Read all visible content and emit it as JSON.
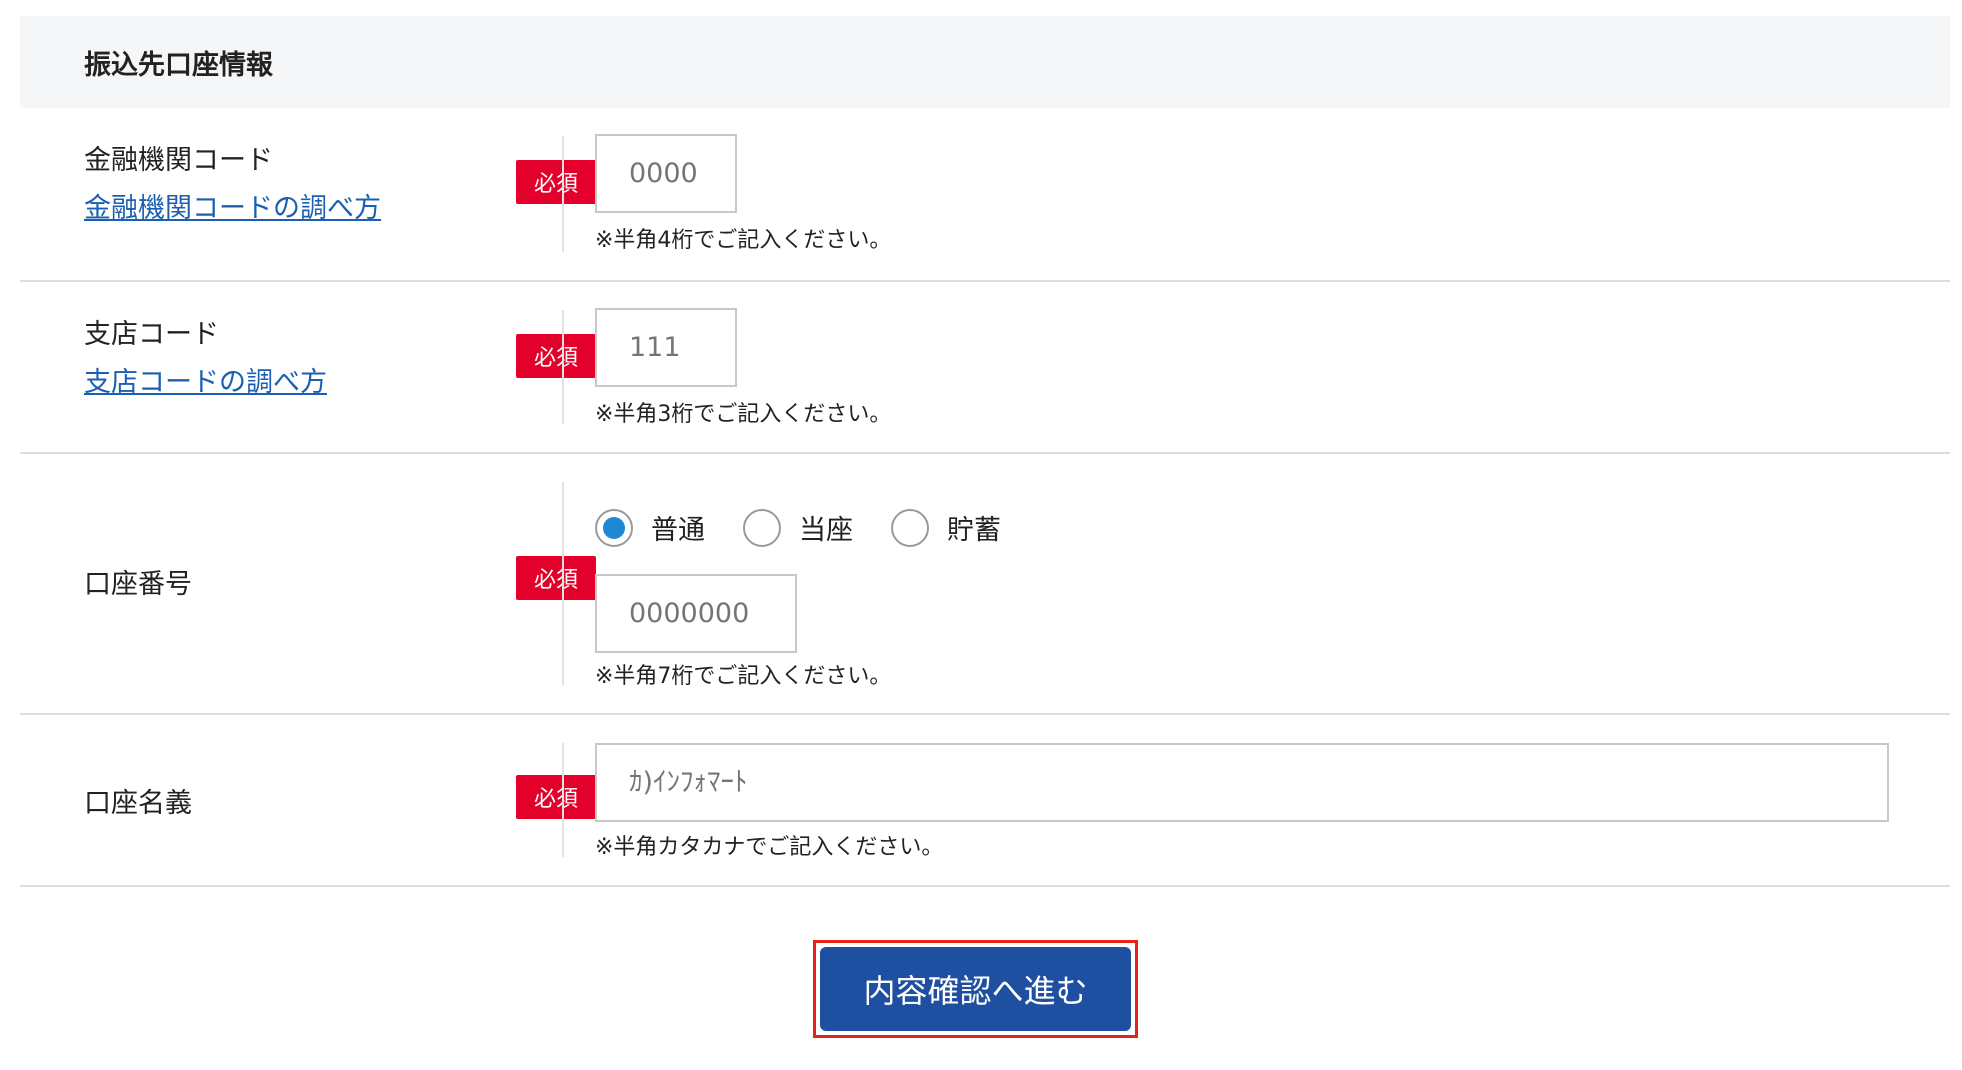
{
  "section": {
    "title": "振込先口座情報"
  },
  "required_badge": "必須",
  "bank_code": {
    "label": "金融機関コード",
    "help_link": "金融機関コードの調べ方",
    "placeholder": "0000",
    "hint": "※半角4桁でご記入ください。"
  },
  "branch_code": {
    "label": "支店コード",
    "help_link": "支店コードの調べ方",
    "placeholder": "111",
    "hint": "※半角3桁でご記入ください。"
  },
  "account_number": {
    "label": "口座番号",
    "account_types": [
      {
        "label": "普通",
        "checked": true
      },
      {
        "label": "当座",
        "checked": false
      },
      {
        "label": "貯蓄",
        "checked": false
      }
    ],
    "placeholder": "0000000",
    "hint": "※半角7桁でご記入ください。"
  },
  "account_name": {
    "label": "口座名義",
    "placeholder": "ｶ)ｲﾝﾌｫﾏｰﾄ",
    "hint": "※半角カタカナでご記入ください。"
  },
  "submit": {
    "label": "内容確認へ進む"
  },
  "colors": {
    "badge": "#e3002b",
    "link": "#1a5fb4",
    "radio_checked": "#1e88d6",
    "submit_bg": "#1f4fa0",
    "highlight_border": "#e4231a"
  }
}
